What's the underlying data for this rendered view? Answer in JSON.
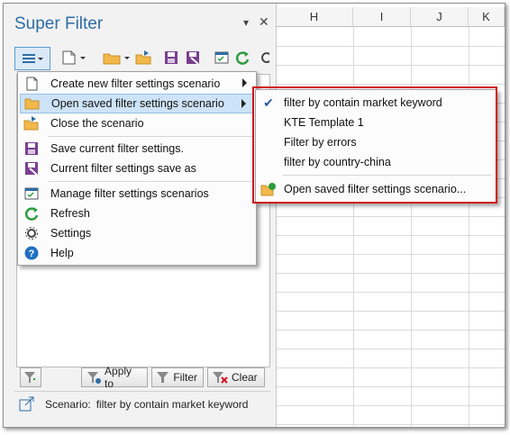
{
  "pane": {
    "title": "Super Filter",
    "pin_label": "▾",
    "close_label": "✕"
  },
  "menu": {
    "items": [
      {
        "label": "Create new filter settings scenario",
        "icon": "new-document-icon"
      },
      {
        "label": "Open saved filter settings scenario",
        "icon": "open-folder-icon"
      },
      {
        "label": "Close the scenario",
        "icon": "close-folder-icon"
      },
      {
        "label": "Save current filter settings.",
        "icon": "save-icon"
      },
      {
        "label": "Current filter settings save as",
        "icon": "save-as-icon"
      },
      {
        "label": "Manage filter settings scenarios",
        "icon": "manage-icon"
      },
      {
        "label": "Refresh",
        "icon": "refresh-icon"
      },
      {
        "label": "Settings",
        "icon": "gear-icon"
      },
      {
        "label": "Help",
        "icon": "help-icon"
      }
    ]
  },
  "submenu": {
    "items": [
      {
        "label": "filter by contain market keyword",
        "checked": true
      },
      {
        "label": "KTE Template 1",
        "checked": false
      },
      {
        "label": "Filter by errors",
        "checked": false
      },
      {
        "label": "filter by country-china",
        "checked": false
      }
    ],
    "open_label": "Open saved filter settings scenario..."
  },
  "buttons": {
    "apply_to": "Apply to",
    "filter": "Filter",
    "clear": "Clear"
  },
  "scenario": {
    "label": "Scenario:",
    "value": "filter by contain market keyword"
  },
  "grid": {
    "columns": [
      "H",
      "I",
      "J",
      "K"
    ]
  },
  "colors": {
    "accent": "#2e6da4",
    "highlight": "#cde3f7",
    "red_box": "#d0141c",
    "green": "#2e9b3e"
  }
}
